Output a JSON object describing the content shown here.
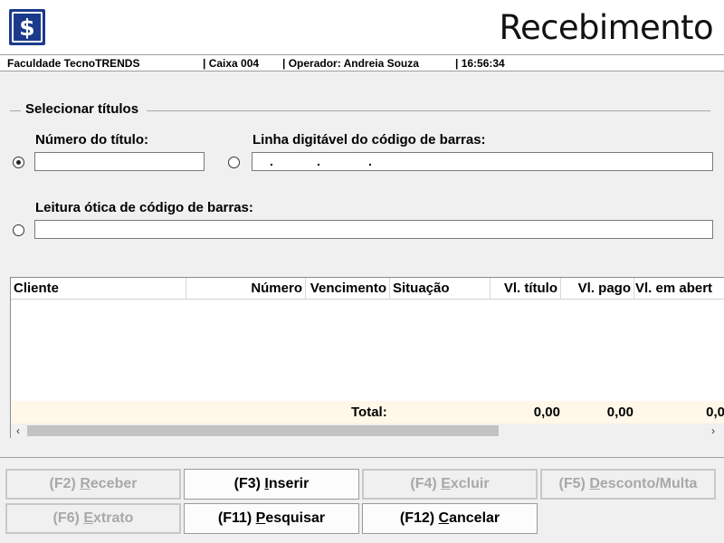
{
  "header": {
    "title": "Recebimento",
    "logo_icon": "dollar-sign-icon",
    "logo_glyph": "$",
    "brand_color": "#1a3a8c"
  },
  "status": {
    "company": "Faculdade TecnoTRENDS",
    "cashier": "| Caixa 004",
    "operator": "| Operador: Andreia Souza",
    "time": "| 16:56:34"
  },
  "selection": {
    "group_title": "Selecionar títulos",
    "titulo_label": "Número do título:",
    "titulo_value": "",
    "barcode_line_label": "Linha digitável do código de barras:",
    "barcode_mask_dot": ".",
    "optical_label": "Leitura ótica de código de barras:",
    "optical_value": "",
    "selected_option": "numero-do-titulo"
  },
  "grid": {
    "columns": [
      "Cliente",
      "Número",
      "Vencimento",
      "Situação",
      "Vl. título",
      "Vl. pago",
      "Vl. em abert"
    ],
    "rows": [],
    "total_label": "Total:",
    "totals": {
      "vl_titulo": "0,00",
      "vl_pago": "0,00",
      "vl_aberto": "0,0"
    }
  },
  "buttons": {
    "receber": {
      "key": "(F2) ",
      "mnemonic": "R",
      "rest": "eceber",
      "enabled": false
    },
    "inserir": {
      "key": "(F3) ",
      "mnemonic": "I",
      "rest": "nserir",
      "enabled": true
    },
    "excluir": {
      "key": "(F4) ",
      "mnemonic": "E",
      "rest": "xcluir",
      "enabled": false
    },
    "desconto": {
      "key": "(F5) ",
      "mnemonic": "D",
      "rest": "esconto/Multa",
      "enabled": false
    },
    "extrato": {
      "key": "(F6) ",
      "mnemonic": "E",
      "rest": "xtrato",
      "enabled": false
    },
    "pesquisar": {
      "key": "(F11) ",
      "mnemonic": "P",
      "rest": "esquisar",
      "enabled": true
    },
    "cancelar": {
      "key": "(F12) ",
      "mnemonic": "C",
      "rest": "ancelar",
      "enabled": true
    }
  }
}
